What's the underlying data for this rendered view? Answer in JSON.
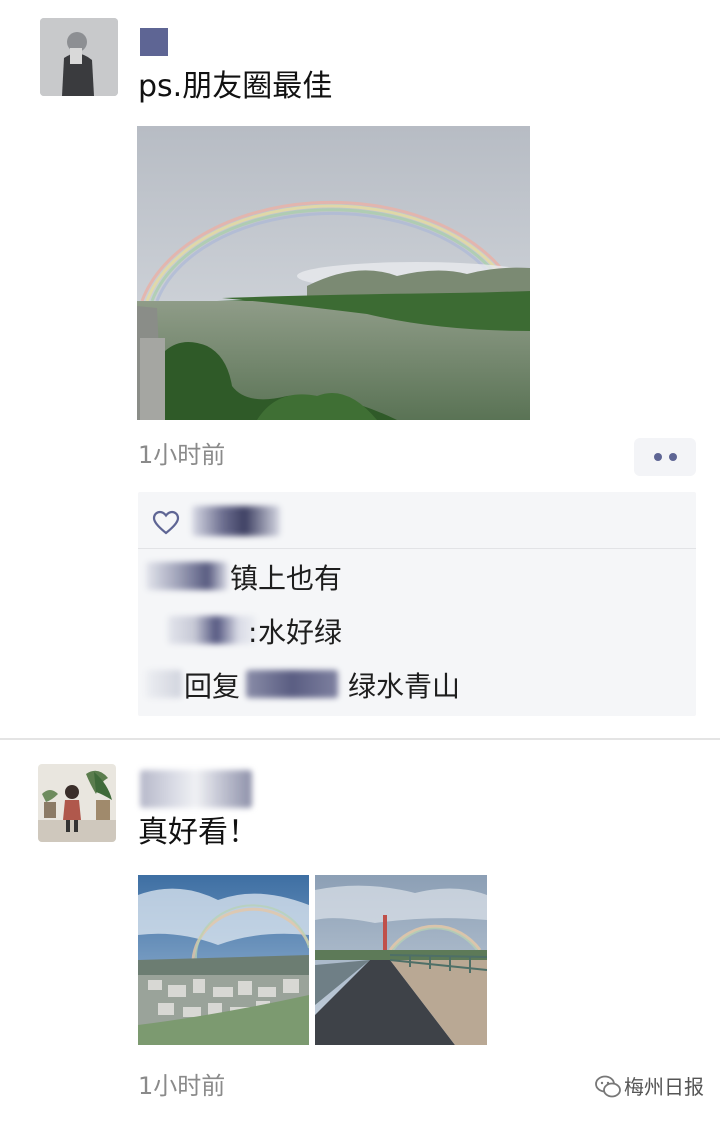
{
  "post1": {
    "text": "ps.朋友圈最佳",
    "time": "1小时前",
    "comments": [
      {
        "text": "镇上也有"
      },
      {
        "text": "水好绿"
      },
      {
        "reply_label": "回复",
        "text": "绿水青山"
      }
    ]
  },
  "post2": {
    "text": "真好看！",
    "time": "1小时前"
  },
  "watermark": {
    "text": "梅州日报"
  },
  "colors": {
    "nickname": "#5e6594",
    "like_icon": "#5e6594",
    "comment_bg": "#f5f6f8",
    "time_text": "#8a8a8a"
  },
  "icons": [
    "heart-icon",
    "more-dots-icon",
    "wechat-logo-icon"
  ]
}
